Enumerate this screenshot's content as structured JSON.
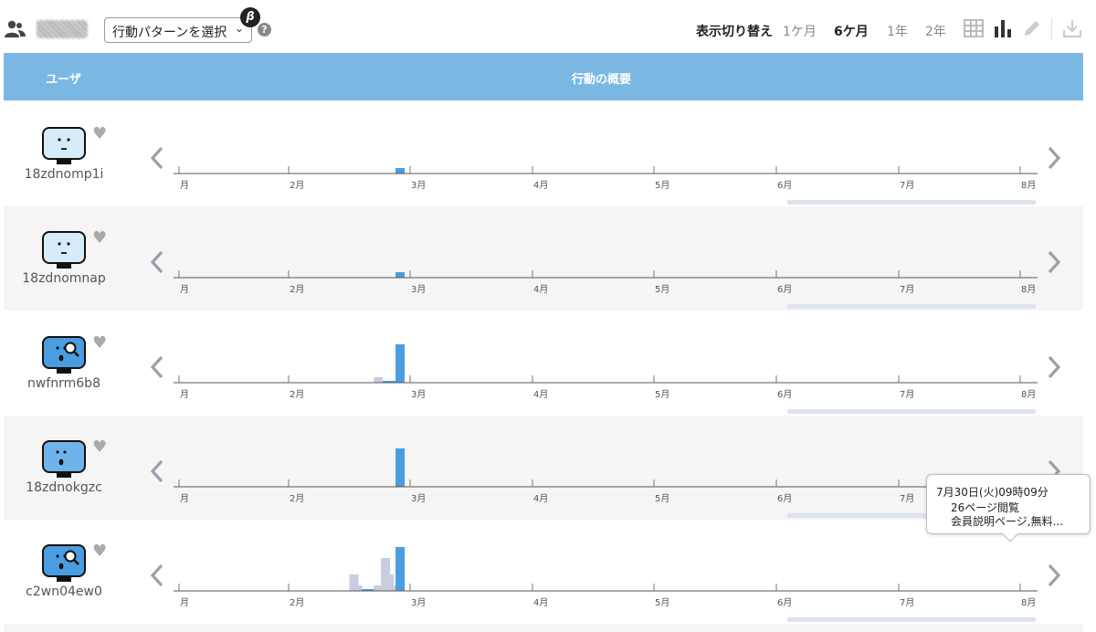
{
  "toolbar": {
    "pattern_select": "行動パターンを選択",
    "beta": "β",
    "help": "?",
    "display_switch": "表示切り替え",
    "periods": [
      "1ケ月",
      "6ケ月",
      "1年",
      "2年"
    ],
    "active_period": "6ケ月"
  },
  "table": {
    "header_user": "ユーザ",
    "header_summary": "行動の概要"
  },
  "months": [
    "月",
    "2月",
    "3月",
    "4月",
    "5月",
    "6月",
    "7月",
    "8月"
  ],
  "users": [
    {
      "name": "18zdnomp1i",
      "avatar": "neutral",
      "avatar_color": "#d6ecfa",
      "bars": [
        {
          "date": "2019-07-30",
          "value": 1
        }
      ],
      "line": []
    },
    {
      "name": "18zdnomnap",
      "avatar": "neutral",
      "avatar_color": "#d6ecfa",
      "bars": [
        {
          "date": "2019-07-30",
          "value": 1
        }
      ],
      "line": []
    },
    {
      "name": "nwfnrm6b8",
      "avatar": "searching",
      "avatar_color": "#4a9de0",
      "bars": [
        {
          "date": "2019-07-12",
          "value": 1,
          "gray": true
        },
        {
          "date": "2019-07-30",
          "value": 7
        }
      ],
      "line": [
        "2019-07-15",
        "2019-07-28"
      ]
    },
    {
      "name": "18zdnokgzc",
      "avatar": "surprised",
      "avatar_color": "#6fb3ea",
      "bars": [
        {
          "date": "2019-07-30",
          "value": 7
        }
      ],
      "line": []
    },
    {
      "name": "c2wn04ew0",
      "avatar": "searching",
      "avatar_color": "#4a9de0",
      "bars": [
        {
          "date": "2019-06-22",
          "value": 3,
          "gray": true
        },
        {
          "date": "2019-06-25",
          "value": 1,
          "gray": true
        },
        {
          "date": "2019-07-12",
          "value": 1,
          "gray": true
        },
        {
          "date": "2019-07-15",
          "value": 1,
          "gray": true
        },
        {
          "date": "2019-07-18",
          "value": 6,
          "gray": true
        },
        {
          "date": "2019-07-21",
          "value": 3,
          "gray": true
        },
        {
          "date": "2019-07-24",
          "value": 1,
          "gray": true
        },
        {
          "date": "2019-07-27",
          "value": 1,
          "gray": true
        },
        {
          "date": "2019-07-30",
          "value": 8
        }
      ],
      "line": [
        "2019-06-25",
        "2019-07-10"
      ]
    }
  ],
  "tooltip": {
    "title": "7月30日(火)09時09分",
    "items": [
      "26ページ閲覧",
      "会員説明ページ,無料..."
    ]
  },
  "colors": {
    "header": "#7ab8e3",
    "bar": "#4a9de0",
    "bar_gray": "#c8cde0",
    "axis": "#555555",
    "scroll": "#dde3ee"
  }
}
